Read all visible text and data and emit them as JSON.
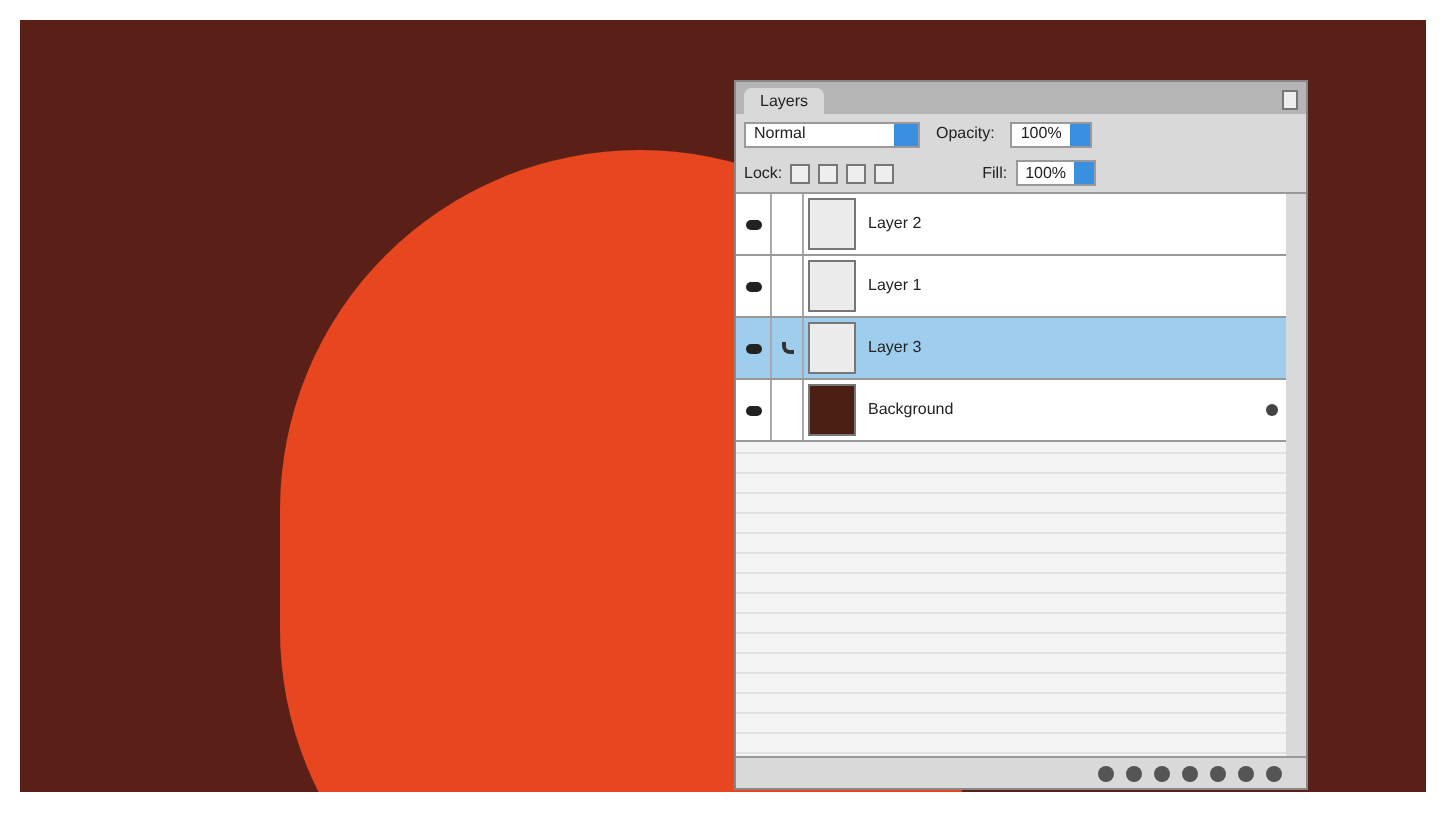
{
  "panel": {
    "tab": "Layers",
    "blend_mode": "Normal",
    "opacity_label": "Opacity:",
    "opacity": "100%",
    "lock_label": "Lock:",
    "fill_label": "Fill:",
    "fill": "100%",
    "layers": [
      {
        "name": "Layer 2",
        "visible": true,
        "selected": false,
        "locked": false
      },
      {
        "name": "Layer 1",
        "visible": true,
        "selected": false,
        "locked": false
      },
      {
        "name": "Layer 3",
        "visible": true,
        "selected": true,
        "locked": false
      },
      {
        "name": "Background",
        "visible": true,
        "selected": false,
        "locked": true
      }
    ]
  }
}
